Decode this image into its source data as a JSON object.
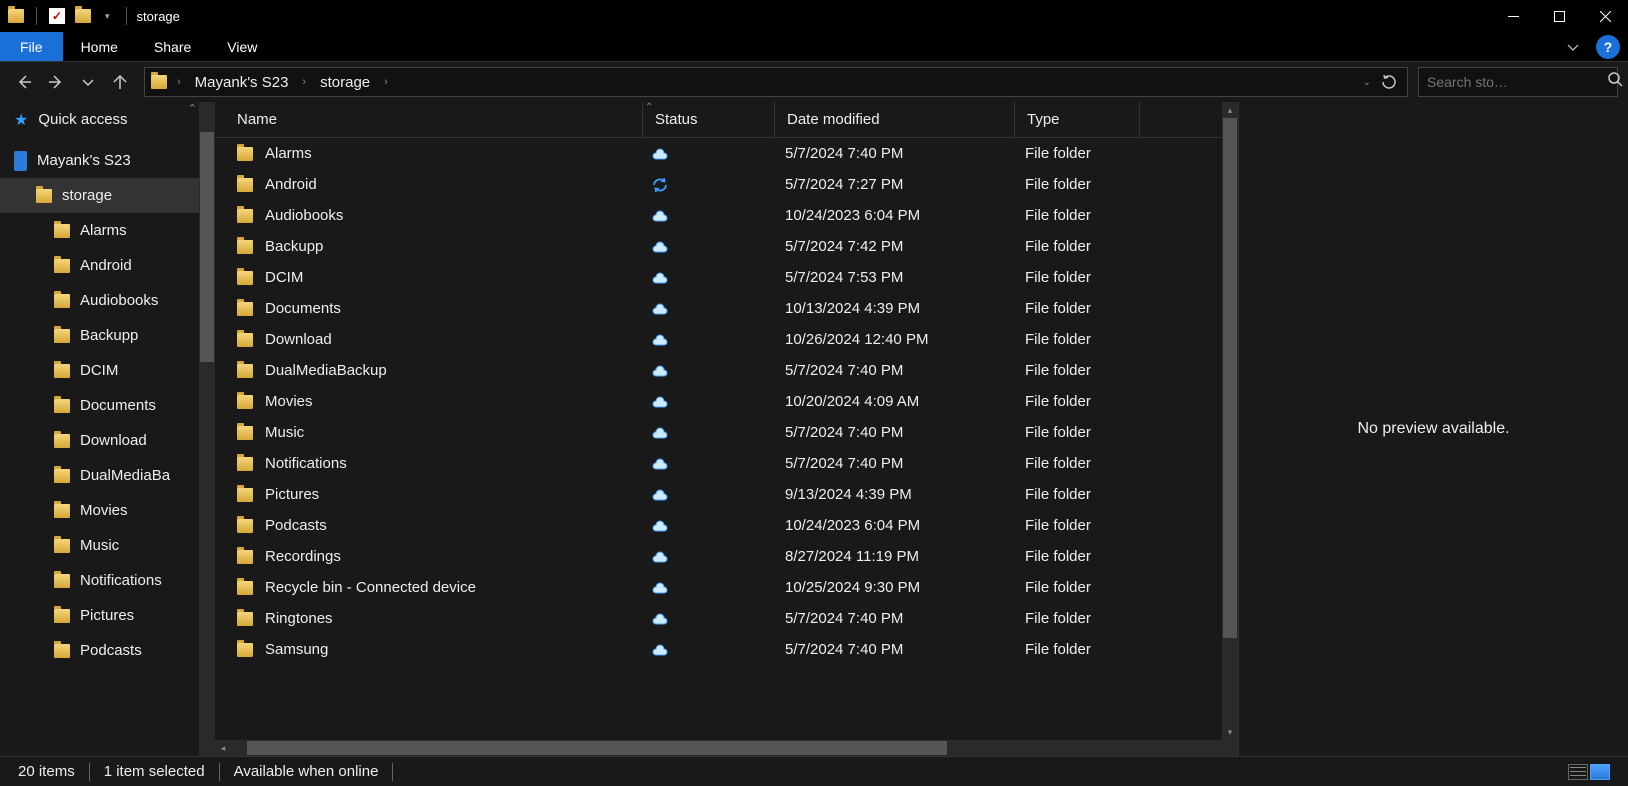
{
  "window_title": "storage",
  "ribbon": {
    "file": "File",
    "tabs": [
      "Home",
      "Share",
      "View"
    ]
  },
  "breadcrumb": [
    "Mayank's S23",
    "storage"
  ],
  "search_placeholder": "Search sto…",
  "sidebar": {
    "quick_access": "Quick access",
    "device": "Mayank's S23",
    "current": "storage",
    "subfolders": [
      "Alarms",
      "Android",
      "Audiobooks",
      "Backupp",
      "DCIM",
      "Documents",
      "Download",
      "DualMediaBa",
      "Movies",
      "Music",
      "Notifications",
      "Pictures",
      "Podcasts"
    ]
  },
  "columns": {
    "name": "Name",
    "status": "Status",
    "date": "Date modified",
    "type": "Type"
  },
  "rows": [
    {
      "name": "Alarms",
      "status": "cloud",
      "date": "5/7/2024 7:40 PM",
      "type": "File folder"
    },
    {
      "name": "Android",
      "status": "sync",
      "date": "5/7/2024 7:27 PM",
      "type": "File folder"
    },
    {
      "name": "Audiobooks",
      "status": "cloud",
      "date": "10/24/2023 6:04 PM",
      "type": "File folder"
    },
    {
      "name": "Backupp",
      "status": "cloud",
      "date": "5/7/2024 7:42 PM",
      "type": "File folder"
    },
    {
      "name": "DCIM",
      "status": "cloud",
      "date": "5/7/2024 7:53 PM",
      "type": "File folder"
    },
    {
      "name": "Documents",
      "status": "cloud",
      "date": "10/13/2024 4:39 PM",
      "type": "File folder"
    },
    {
      "name": "Download",
      "status": "cloud",
      "date": "10/26/2024 12:40 PM",
      "type": "File folder"
    },
    {
      "name": "DualMediaBackup",
      "status": "cloud",
      "date": "5/7/2024 7:40 PM",
      "type": "File folder"
    },
    {
      "name": "Movies",
      "status": "cloud",
      "date": "10/20/2024 4:09 AM",
      "type": "File folder"
    },
    {
      "name": "Music",
      "status": "cloud",
      "date": "5/7/2024 7:40 PM",
      "type": "File folder"
    },
    {
      "name": "Notifications",
      "status": "cloud",
      "date": "5/7/2024 7:40 PM",
      "type": "File folder"
    },
    {
      "name": "Pictures",
      "status": "cloud",
      "date": "9/13/2024 4:39 PM",
      "type": "File folder"
    },
    {
      "name": "Podcasts",
      "status": "cloud",
      "date": "10/24/2023 6:04 PM",
      "type": "File folder"
    },
    {
      "name": "Recordings",
      "status": "cloud",
      "date": "8/27/2024 11:19 PM",
      "type": "File folder"
    },
    {
      "name": "Recycle bin - Connected device",
      "status": "cloud",
      "date": "10/25/2024 9:30 PM",
      "type": "File folder"
    },
    {
      "name": "Ringtones",
      "status": "cloud",
      "date": "5/7/2024 7:40 PM",
      "type": "File folder"
    },
    {
      "name": "Samsung",
      "status": "cloud",
      "date": "5/7/2024 7:40 PM",
      "type": "File folder"
    }
  ],
  "preview_text": "No preview available.",
  "status": {
    "count": "20 items",
    "selected": "1 item selected",
    "availability": "Available when online"
  }
}
